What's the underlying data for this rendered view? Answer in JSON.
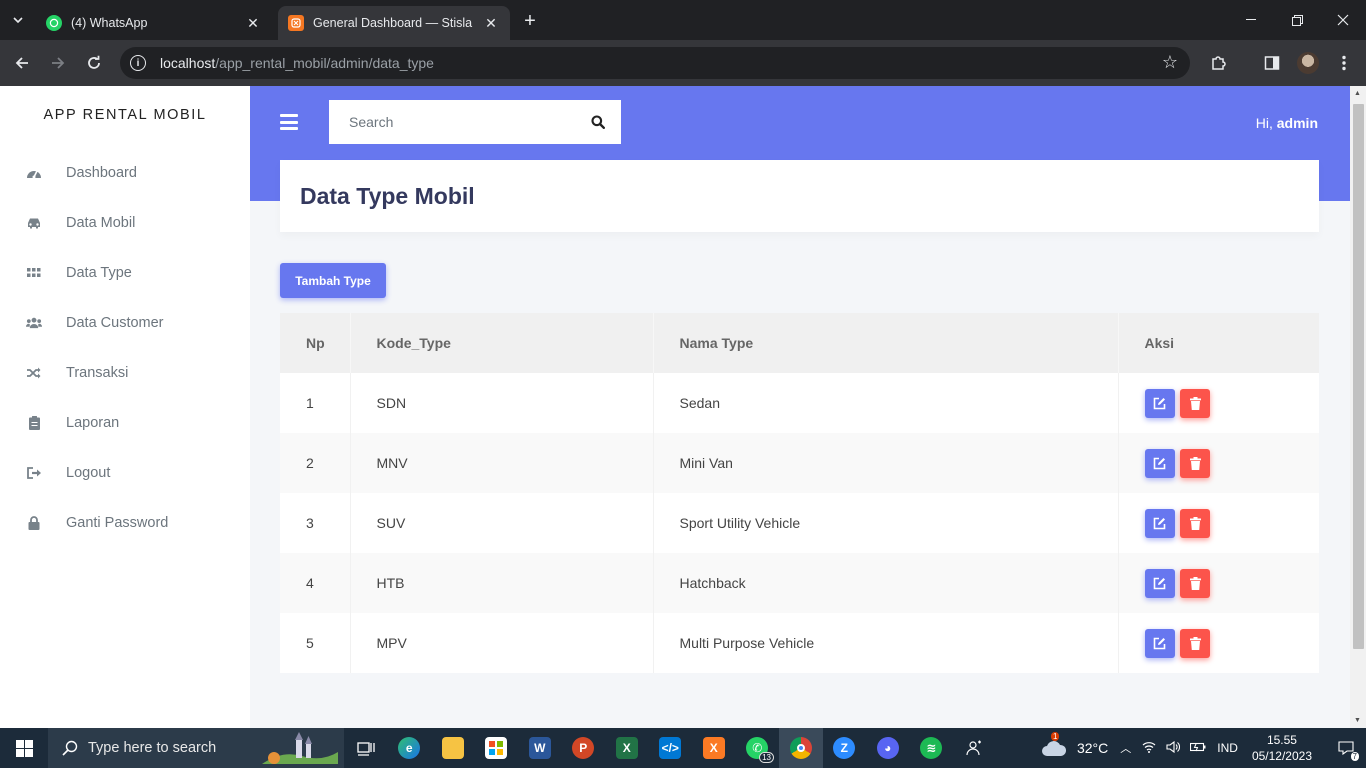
{
  "browser": {
    "tabs": [
      {
        "title": "(4) WhatsApp",
        "favicon": "whatsapp-icon"
      },
      {
        "title": "General Dashboard — Stisla",
        "favicon": "stisla-icon",
        "active": true
      }
    ],
    "url_host": "localhost",
    "url_path": "/app_rental_mobil/admin/data_type"
  },
  "sidebar": {
    "brand": "APP RENTAL MOBIL",
    "items": [
      {
        "label": "Dashboard",
        "icon": "tachometer-icon"
      },
      {
        "label": "Data Mobil",
        "icon": "car-icon"
      },
      {
        "label": "Data Type",
        "icon": "grid-icon"
      },
      {
        "label": "Data Customer",
        "icon": "users-icon"
      },
      {
        "label": "Transaksi",
        "icon": "random-icon"
      },
      {
        "label": "Laporan",
        "icon": "clipboard-icon"
      },
      {
        "label": "Logout",
        "icon": "sign-out-icon"
      },
      {
        "label": "Ganti Password",
        "icon": "lock-icon"
      }
    ]
  },
  "navbar": {
    "search_placeholder": "Search",
    "greeting_prefix": "Hi,",
    "greeting_user": "admin"
  },
  "page": {
    "title": "Data Type Mobil",
    "add_button": "Tambah Type"
  },
  "table": {
    "headers": [
      "Np",
      "Kode_Type",
      "Nama Type",
      "Aksi"
    ],
    "rows": [
      {
        "no": "1",
        "kode": "SDN",
        "nama": "Sedan"
      },
      {
        "no": "2",
        "kode": "MNV",
        "nama": "Mini Van"
      },
      {
        "no": "3",
        "kode": "SUV",
        "nama": "Sport Utility Vehicle"
      },
      {
        "no": "4",
        "kode": "HTB",
        "nama": "Hatchback"
      },
      {
        "no": "5",
        "kode": "MPV",
        "nama": "Multi Purpose Vehicle"
      }
    ]
  },
  "taskbar": {
    "search_placeholder": "Type here to search",
    "whatsapp_badge": "13",
    "weather_badge": "1",
    "temperature": "32°C",
    "language": "IND",
    "time": "15.55",
    "date": "05/12/2023",
    "notification_count": "7"
  },
  "colors": {
    "primary": "#6777ef",
    "danger": "#fc544b",
    "page_bg": "#f4f6f9"
  }
}
